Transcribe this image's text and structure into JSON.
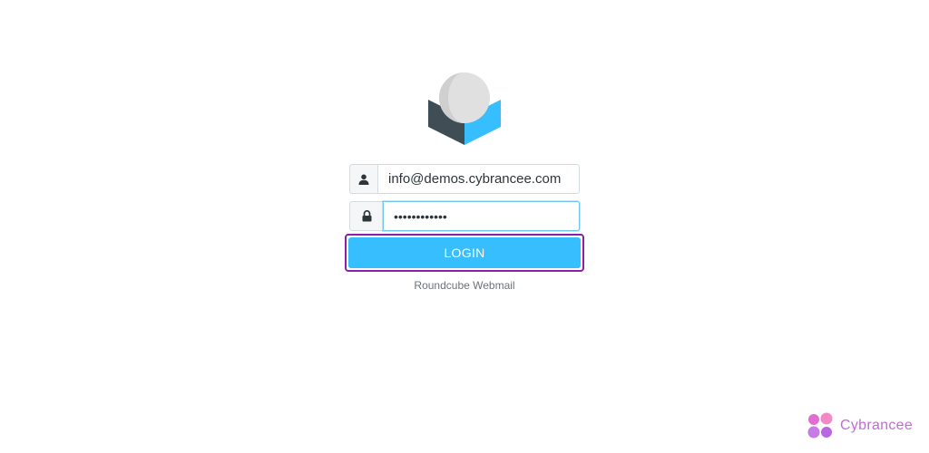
{
  "login": {
    "username_value": "info@demos.cybrancee.com",
    "password_value": "••••••••••••",
    "login_label": "LOGIN",
    "product_name": "Roundcube Webmail"
  },
  "icons": {
    "username": "user-icon",
    "password": "lock-icon",
    "logo": "roundcube-logo"
  },
  "watermark": {
    "brand_name": "Cybrancee",
    "brand_icon": "four-dots-icon",
    "color": "#c46ad8"
  },
  "colors": {
    "accent": "#37beff",
    "focus_border": "#71c6ef",
    "highlight_frame": "#8b1fa9"
  }
}
